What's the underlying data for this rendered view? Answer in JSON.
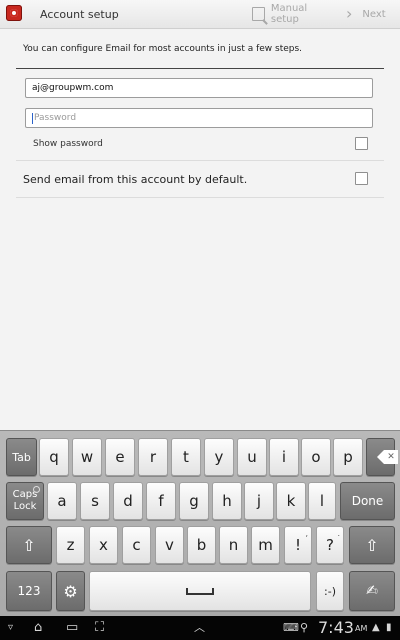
{
  "actionbar": {
    "title": "Account setup",
    "manual_setup": "Manual setup",
    "next": "Next"
  },
  "form": {
    "intro": "You can configure Email for most accounts in just a few steps.",
    "email_value": "aj@groupwm.com",
    "password_placeholder": "Password",
    "show_password_label": "Show password",
    "show_password_checked": false,
    "default_label": "Send email from this account by default.",
    "default_checked": false
  },
  "keyboard": {
    "row1": [
      "q",
      "w",
      "e",
      "r",
      "t",
      "y",
      "u",
      "i",
      "o",
      "p"
    ],
    "row2": [
      "a",
      "s",
      "d",
      "f",
      "g",
      "h",
      "j",
      "k",
      "l"
    ],
    "row3": [
      "z",
      "x",
      "c",
      "v",
      "b",
      "n",
      "m"
    ],
    "tab": "Tab",
    "caps": "Caps\nLock",
    "done": "Done",
    "excl": "!",
    "excl_alt": ",",
    "quest": "?",
    "quest_alt": ".",
    "num": "123",
    "smiley": ":-)"
  },
  "status": {
    "time": "7:43",
    "ampm": "AM"
  },
  "colors": {
    "accent_cursor": "#2a62c9",
    "keyboard_bg": "#b0b0b0",
    "status_bar": "#050505"
  }
}
